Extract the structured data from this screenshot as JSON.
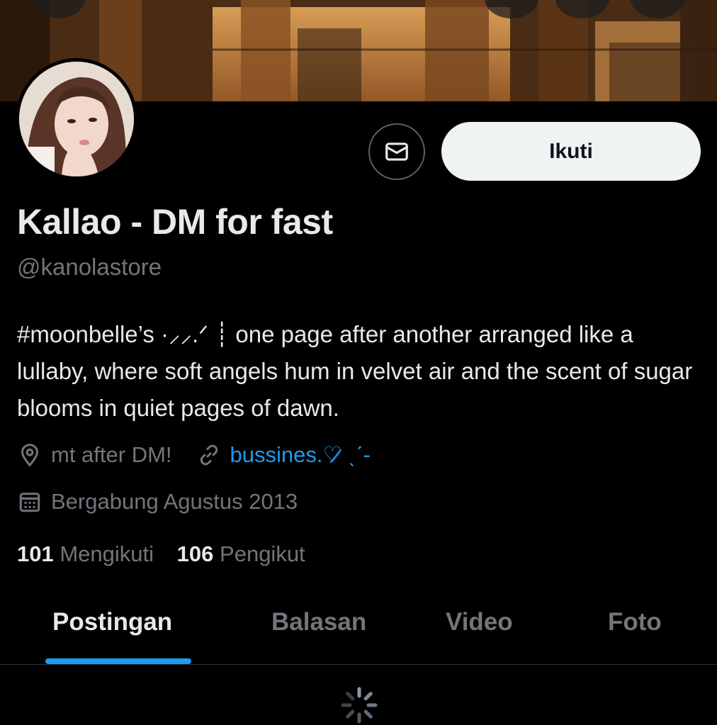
{
  "profile": {
    "display_name": "Kallao - DM for fast",
    "handle": "@kanolastore",
    "bio": "#moonbelle’s ·⸝⸝.ᐟ ┊ one page after another arranged like a lullaby, where soft angels hum in velvet air and the scent of sugar blooms in quiet pages of dawn.",
    "location": "mt after DM!",
    "website": "bussines.♡̷ ˎˊ-",
    "joined": "Bergabung Agustus 2013"
  },
  "stats": {
    "following_count": "101",
    "following_label": "Mengikuti",
    "followers_count": "106",
    "followers_label": "Pengikut"
  },
  "actions": {
    "follow_label": "Ikuti",
    "message_icon": "envelope-icon"
  },
  "tabs": [
    {
      "label": "Postingan",
      "active": true
    },
    {
      "label": "Balasan",
      "active": false
    },
    {
      "label": "Video",
      "active": false
    },
    {
      "label": "Foto",
      "active": false
    }
  ],
  "colors": {
    "background": "#000000",
    "text_primary": "#e7e9ea",
    "text_secondary": "#71767b",
    "accent": "#1d9bf0",
    "follow_button_bg": "#eff3f4"
  },
  "icons": [
    "location-pin-icon",
    "link-icon",
    "calendar-icon",
    "loading-spinner-icon"
  ]
}
